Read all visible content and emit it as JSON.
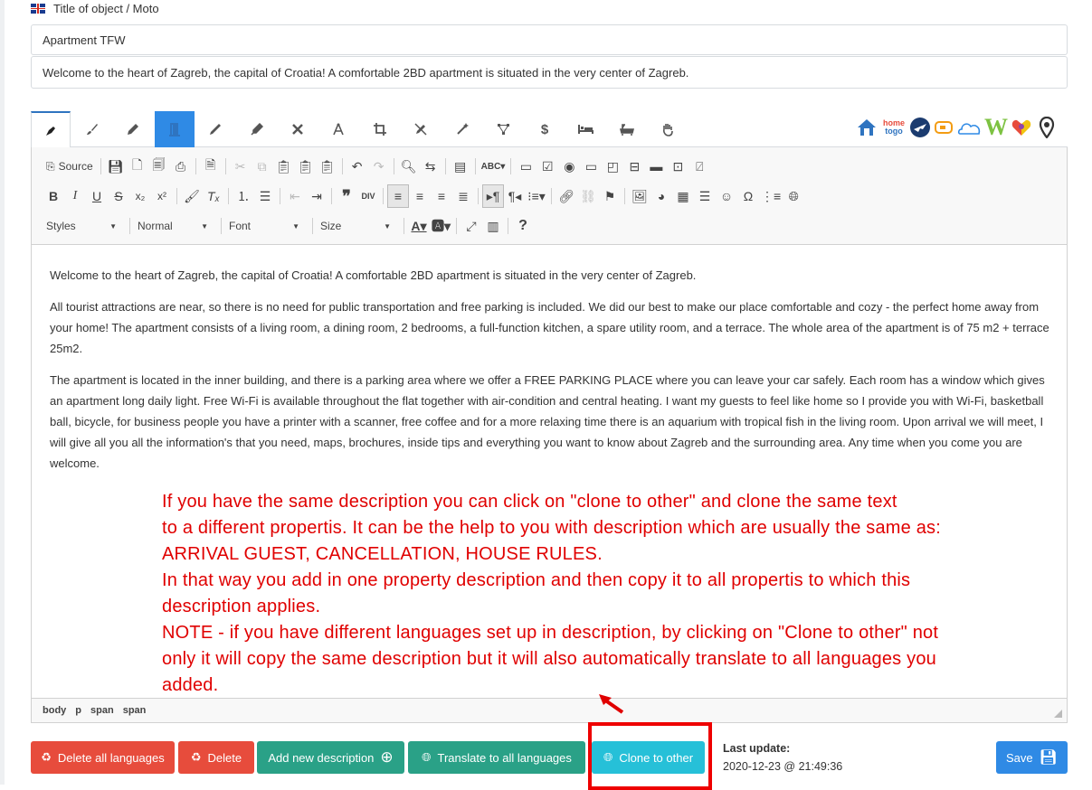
{
  "header": {
    "title": "Title of object / Moto"
  },
  "fields": {
    "title_value": "Apartment TFW",
    "summary_value": "Welcome to the heart of Zagreb, the capital of Croatia! A comfortable 2BD apartment is situated in the very center of Zagreb."
  },
  "tabs": [
    "pen-nib",
    "brush",
    "marker",
    "door",
    "pencil",
    "pen",
    "pencil-ruler",
    "compass",
    "crop",
    "pen-slash",
    "magic-wand",
    "vector",
    "dollar",
    "bed",
    "bath",
    "hand"
  ],
  "channels": [
    "homeaway",
    "hometogo",
    "expedia",
    "bookingsync",
    "airbnb",
    "wix",
    "colorful-logo",
    "map-pin"
  ],
  "toolbar": {
    "source_label": "Source",
    "styles_label": "Styles",
    "format_label": "Normal",
    "font_label": "Font",
    "size_label": "Size"
  },
  "editor": {
    "paragraphs": [
      "Welcome to the heart of Zagreb, the capital of Croatia! A comfortable 2BD apartment is situated in the very center of Zagreb.",
      "All tourist attractions are near, so there is no need for public transportation and free parking is included. We did our best to make our place comfortable and cozy - the perfect home away from your home! The apartment consists of a living room, a dining room, 2 bedrooms, a full-function kitchen, a spare utility room, and a terrace. The whole area of the apartment is of 75 m2 + terrace 25m2.",
      "The apartment is located in the inner building, and there is a parking area where we offer a FREE PARKING PLACE where you can leave your car safely. Each room has a window which gives an apartment long daily light. Free Wi-Fi is available throughout the flat together with air-condition and central heating. I want my guests to feel like home so I provide you with Wi-Fi, basketball ball, bicycle, for business people you have a printer with a scanner, free coffee and for a more relaxing time there is an aquarium with tropical fish in the living room. Upon arrival we will meet, I will give all you all the information's that you need, maps, brochures, inside tips and everything you want to know about Zagreb and the surrounding area. Any time when you come you are welcome."
    ],
    "path": [
      "body",
      "p",
      "span",
      "span"
    ]
  },
  "annotation": {
    "lines": [
      "If you have the same description you can click on \"clone to other\" and clone the same text",
      "to a different propertis. It can be the help to you with description which are usually the same as:",
      "ARRIVAL GUEST, CANCELLATION, HOUSE RULES.",
      "In that way you add in one property description and then copy it to all propertis to which this",
      "description applies.",
      "NOTE - if you have different languages set up in description, by clicking on \"Clone to other\" not",
      "only it will copy the same description but it will also automatically translate to all languages you",
      "added."
    ]
  },
  "buttons": {
    "delete_all": "Delete all languages",
    "delete": "Delete",
    "add_new": "Add new description",
    "translate": "Translate to all languages",
    "clone": "Clone to other",
    "save": "Save"
  },
  "last_update": {
    "label": "Last update:",
    "value": "2020-12-23 @ 21:49:36"
  },
  "colors": {
    "red": "#e74c3c",
    "teal": "#2aa187",
    "cyan": "#26c0d8",
    "blue": "#2f8ae5",
    "annotation": "#e00000"
  }
}
